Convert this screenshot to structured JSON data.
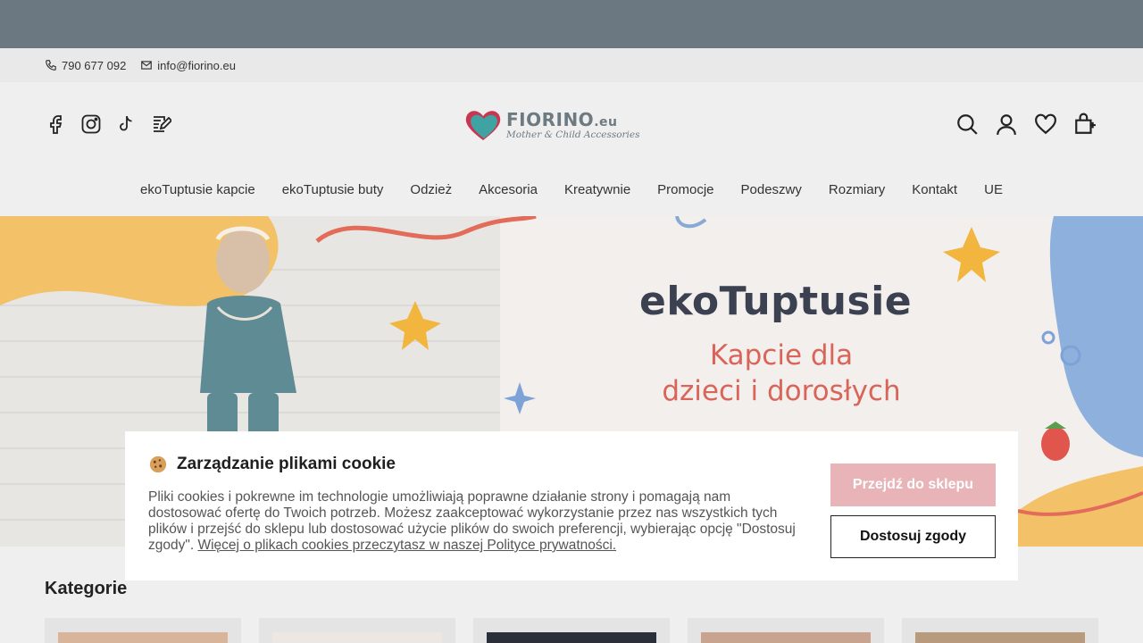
{
  "contact": {
    "phone": "790 677 092",
    "email": "info@fiorino.eu"
  },
  "logo": {
    "name": "FIORINO",
    "suffix": ".eu",
    "tagline": "Mother & Child Accessories"
  },
  "nav": {
    "items": [
      "ekoTuptusie kapcie",
      "ekoTuptusie buty",
      "Odzież",
      "Akcesoria",
      "Kreatywnie",
      "Promocje",
      "Podeszwy",
      "Rozmiary",
      "Kontakt",
      "UE"
    ]
  },
  "hero": {
    "title": "ekoTuptusie",
    "subtitle_line1": "Kapcie dla",
    "subtitle_line2": "dzieci i dorosłych"
  },
  "categories": {
    "heading": "Kategorie"
  },
  "cookie": {
    "title": "Zarządzanie plikami cookie",
    "text": "Pliki cookies i pokrewne im technologie umożliwiają poprawne działanie strony i pomagają nam dostosować ofertę do Twoich potrzeb. Możesz zaakceptować wykorzystanie przez nas wszystkich tych plików i przejść do sklepu lub dostosować użycie plików do swoich preferencji, wybierając opcję \"Dostosuj zgody\". ",
    "link": "Więcej o plikach cookies przeczytasz w naszej Polityce prywatności.",
    "accept_button": "Przejdź do sklepu",
    "customize_button": "Dostosuj zgody"
  },
  "colors": {
    "accent_pink": "#e8b4b8",
    "logo_grey": "#6e7a82",
    "hero_title": "#3b4150",
    "hero_subtitle": "#d9655a"
  }
}
